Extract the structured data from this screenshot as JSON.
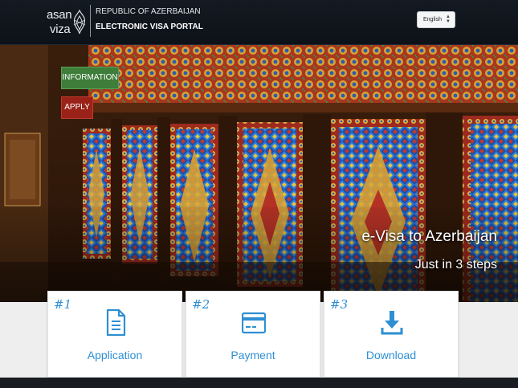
{
  "header": {
    "logo_line1": "asan",
    "logo_line2": "viza",
    "country": "REPUBLIC OF AZERBAIJAN",
    "portal": "ELECTRONIC VISA PORTAL",
    "language_selected": "English"
  },
  "hero": {
    "buttons": {
      "information": "INFORMATION",
      "apply": "APPLY"
    },
    "tagline": "e-Visa to Azerbaijan",
    "subtagline": "Just in 3 steps"
  },
  "steps": [
    {
      "number": "#1",
      "label": "Application",
      "icon": "document-icon"
    },
    {
      "number": "#2",
      "label": "Payment",
      "icon": "credit-card-icon"
    },
    {
      "number": "#3",
      "label": "Download",
      "icon": "download-icon"
    }
  ],
  "colors": {
    "accent_blue": "#2e8fd3",
    "info_green": "#3f7d3b",
    "apply_red": "#9b2218",
    "header_bg": "#141a22"
  }
}
